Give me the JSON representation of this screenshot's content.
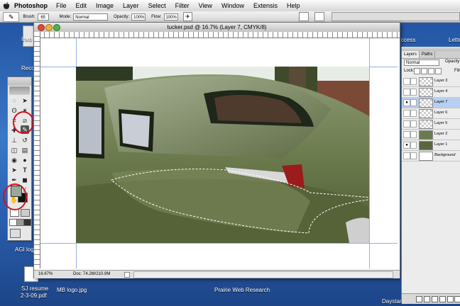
{
  "menubar": {
    "app_name": "Photoshop",
    "items": [
      "File",
      "Edit",
      "Image",
      "Layer",
      "Select",
      "Filter",
      "View",
      "Window",
      "Extensis",
      "Help"
    ]
  },
  "options_bar": {
    "brush_label": "Brush:",
    "brush_size": "65",
    "mode_label": "Mode:",
    "mode_value": "Normal",
    "opacity_label": "Opacity:",
    "opacity_value": "100%",
    "flow_label": "Flow:",
    "flow_value": "100%"
  },
  "document": {
    "title": "tucker.psd @ 16.7% (Layer 7, CMYK/8)",
    "zoom": "16.67%",
    "doc_size": "Doc: 74.2M/210.9M"
  },
  "layers_panel": {
    "tabs": [
      "Layers",
      "Paths"
    ],
    "blend_mode": "Normal",
    "opacity_label": "Opacity",
    "lock_label": "Lock:",
    "fill_label": "Fill",
    "layers": [
      {
        "name": "Layer 3",
        "visible": false,
        "selected": false
      },
      {
        "name": "Layer 4",
        "visible": false,
        "selected": false
      },
      {
        "name": "Layer 7",
        "visible": true,
        "selected": true
      },
      {
        "name": "Layer 6",
        "visible": false,
        "selected": false
      },
      {
        "name": "Layer 5",
        "visible": false,
        "selected": false
      },
      {
        "name": "Layer 2",
        "visible": false,
        "selected": false
      },
      {
        "name": "Layer 1",
        "visible": true,
        "selected": false
      },
      {
        "name": "Background",
        "visible": false,
        "selected": false
      }
    ]
  },
  "desktop": {
    "labels": {
      "invo": "Invo",
      "reco": "Reco",
      "agi_logo": "AGI logo",
      "sj_resume_1": "SJ resume",
      "sj_resume_2": "2-3-09.pdf",
      "mb_logo": "MB logo.jpg",
      "prairie": "Prairie Web Research",
      "daystar": "DaystarPassportDir",
      "access": "ccess",
      "lette": "Lette"
    }
  },
  "colors": {
    "highlight_circle": "#d3121d",
    "car_green": "#6f7f52",
    "selected_layer": "#b7cff0"
  }
}
